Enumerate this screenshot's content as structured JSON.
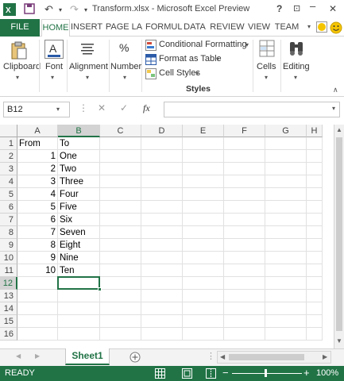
{
  "window": {
    "title": "Transform.xlsx - Microsoft Excel Preview",
    "help": "?",
    "minimize": "–",
    "restore": "❐",
    "close": "✕"
  },
  "tabs": [
    "FILE",
    "HOME",
    "INSERT",
    "PAGE LA",
    "FORMUL",
    "DATA",
    "REVIEW",
    "VIEW",
    "TEAM"
  ],
  "active_tab": "HOME",
  "ribbon": {
    "clipboard": "Clipboard",
    "font": "Font",
    "alignment": "Alignment",
    "number": "Number",
    "percent_symbol": "%",
    "conditional_formatting": "Conditional Formatting",
    "format_as_table": "Format as Table",
    "cell_styles": "Cell Styles",
    "styles_group": "Styles",
    "cells": "Cells",
    "editing": "Editing"
  },
  "formula_bar": {
    "name_box": "B12",
    "fx": "fx",
    "cancel": "✕",
    "enter": "✓",
    "formula": ""
  },
  "columns": [
    "A",
    "B",
    "C",
    "D",
    "E",
    "F",
    "G",
    "H"
  ],
  "selected_column": "B",
  "rows": [
    {
      "n": "1",
      "a": "From",
      "b": "To"
    },
    {
      "n": "2",
      "a": "1",
      "b": "One"
    },
    {
      "n": "3",
      "a": "2",
      "b": "Two"
    },
    {
      "n": "4",
      "a": "3",
      "b": "Three"
    },
    {
      "n": "5",
      "a": "4",
      "b": "Four"
    },
    {
      "n": "6",
      "a": "5",
      "b": "Five"
    },
    {
      "n": "7",
      "a": "6",
      "b": "Six"
    },
    {
      "n": "8",
      "a": "7",
      "b": "Seven"
    },
    {
      "n": "9",
      "a": "8",
      "b": "Eight"
    },
    {
      "n": "10",
      "a": "9",
      "b": "Nine"
    },
    {
      "n": "11",
      "a": "10",
      "b": "Ten"
    },
    {
      "n": "12",
      "a": "",
      "b": ""
    },
    {
      "n": "13",
      "a": "",
      "b": ""
    },
    {
      "n": "14",
      "a": "",
      "b": ""
    },
    {
      "n": "15",
      "a": "",
      "b": ""
    },
    {
      "n": "16",
      "a": "",
      "b": ""
    }
  ],
  "selected_row": "12",
  "sheet_tab": "Sheet1",
  "status": {
    "ready": "READY",
    "zoom": "100%"
  },
  "colors": {
    "accent": "#217346",
    "header_bg": "#f3f3f3",
    "gridline": "#e1e1e1"
  }
}
